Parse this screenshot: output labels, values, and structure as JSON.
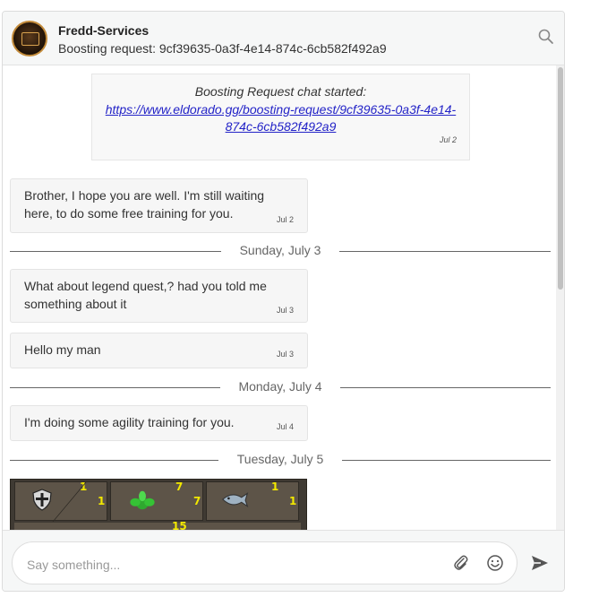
{
  "header": {
    "title": "Fredd-Services",
    "subtitle": "Boosting request: 9cf39635-0a3f-4e14-874c-6cb582f492a9",
    "search_icon": "search-icon"
  },
  "system_message": {
    "text": "Boosting Request chat started:",
    "link_line1": "https://www.eldorado.gg/boosting-request/9cf39635-0a3f-4e14-",
    "link_line2": "874c-6cb582f492a9",
    "time": "Jul 2"
  },
  "messages": [
    {
      "line1": "Brother, I hope you are well. I'm still waiting",
      "line2": "here, to do some free training for you.",
      "time": "Jul 2"
    },
    {
      "line1": "What about legend quest,? had you told me",
      "line2": "something about it",
      "time": "Jul 3"
    },
    {
      "line1": "Hello my man",
      "time": "Jul 3"
    },
    {
      "line1": "I'm doing some agility training for you.",
      "time": "Jul 4"
    }
  ],
  "dividers": [
    "Sunday, July 3",
    "Monday, July 4",
    "Tuesday, July 5"
  ],
  "game_image": {
    "skills": [
      {
        "icon": "defence-icon",
        "level": "1",
        "max": "1"
      },
      {
        "icon": "herblore-icon",
        "level": "7",
        "max": "7"
      },
      {
        "icon": "fishing-icon",
        "level": "1",
        "max": "1"
      }
    ],
    "partial_number": "15"
  },
  "composer": {
    "placeholder": "Say something...",
    "attach_icon": "paperclip-icon",
    "emoji_icon": "emoji-icon",
    "send_icon": "send-icon"
  },
  "colors": {
    "link": "#2323c7",
    "header_bg": "#f6f7f7",
    "bubble_bg": "#f6f6f6"
  }
}
